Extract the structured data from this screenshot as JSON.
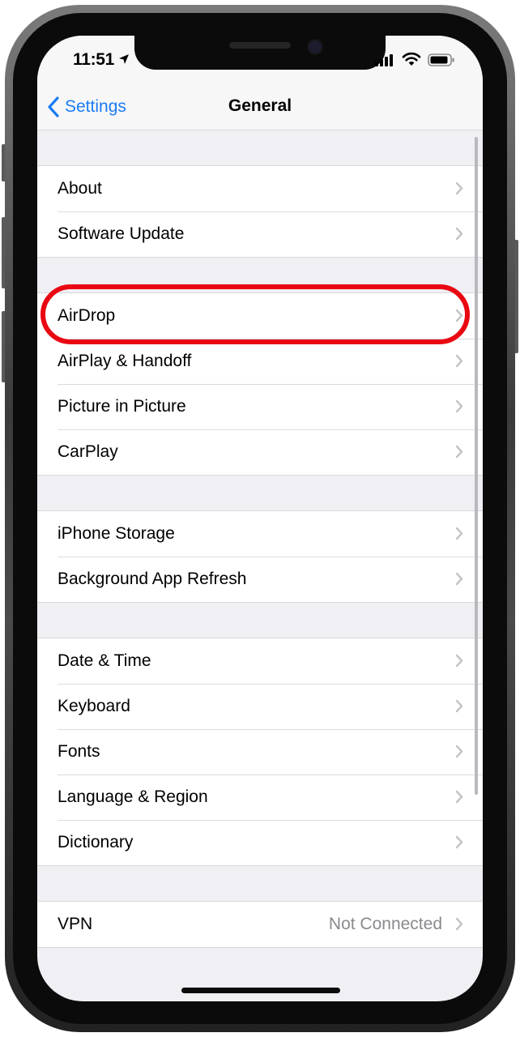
{
  "status_bar": {
    "time": "11:51"
  },
  "nav": {
    "back_label": "Settings",
    "title": "General"
  },
  "groups": [
    {
      "rows": [
        {
          "label": "About"
        },
        {
          "label": "Software Update"
        }
      ]
    },
    {
      "rows": [
        {
          "label": "AirDrop"
        },
        {
          "label": "AirPlay & Handoff"
        },
        {
          "label": "Picture in Picture"
        },
        {
          "label": "CarPlay"
        }
      ]
    },
    {
      "rows": [
        {
          "label": "iPhone Storage"
        },
        {
          "label": "Background App Refresh"
        }
      ]
    },
    {
      "rows": [
        {
          "label": "Date & Time"
        },
        {
          "label": "Keyboard"
        },
        {
          "label": "Fonts"
        },
        {
          "label": "Language & Region"
        },
        {
          "label": "Dictionary"
        }
      ]
    },
    {
      "rows": [
        {
          "label": "VPN",
          "value": "Not Connected"
        }
      ]
    }
  ],
  "icons": {
    "back": "chevron-left-icon",
    "row_disclosure": "chevron-right-icon",
    "status": [
      "location-arrow-icon",
      "signal-icon",
      "wifi-icon",
      "battery-icon"
    ]
  },
  "colors": {
    "accent": "#1a7cf5",
    "highlight": "#e90712",
    "background": "#efeff4",
    "value_text": "#8a8a8e"
  }
}
